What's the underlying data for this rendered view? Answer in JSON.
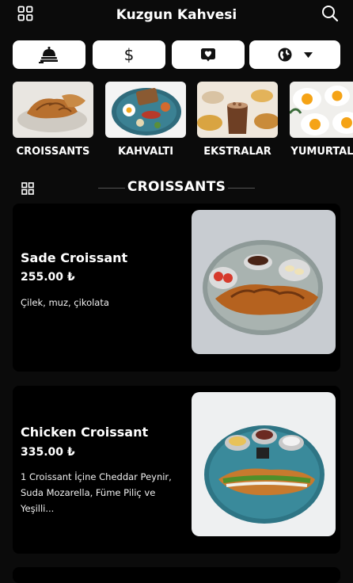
{
  "header": {
    "title": "Kuzgun Kahvesi",
    "menu_icon": "grid-icon",
    "search_icon": "search-icon"
  },
  "actions": {
    "service_icon": "waiter-bell-icon",
    "currency_symbol": "$",
    "favorites_icon": "heart-icon",
    "language_icon": "globe-icon"
  },
  "categories": [
    {
      "label": "CROISSANTS"
    },
    {
      "label": "KAHVALTI"
    },
    {
      "label": "EKSTRALAR"
    },
    {
      "label": "YUMURTALAR"
    }
  ],
  "section": {
    "title": "CROISSANTS",
    "icon": "grid-icon"
  },
  "products": [
    {
      "name": "Sade Croissant",
      "price": "255.00 ₺",
      "description": "Çilek, muz, çikolata"
    },
    {
      "name": "Chicken Croissant",
      "price": "335.00 ₺",
      "description": "1 Croissant İçine Cheddar Peynir, Suda Mozarella, Füme Piliç ve Yeşilli..."
    }
  ],
  "colors": {
    "background": "#0b0b0b",
    "card": "#000000",
    "button": "#ffffff",
    "text": "#ffffff"
  }
}
